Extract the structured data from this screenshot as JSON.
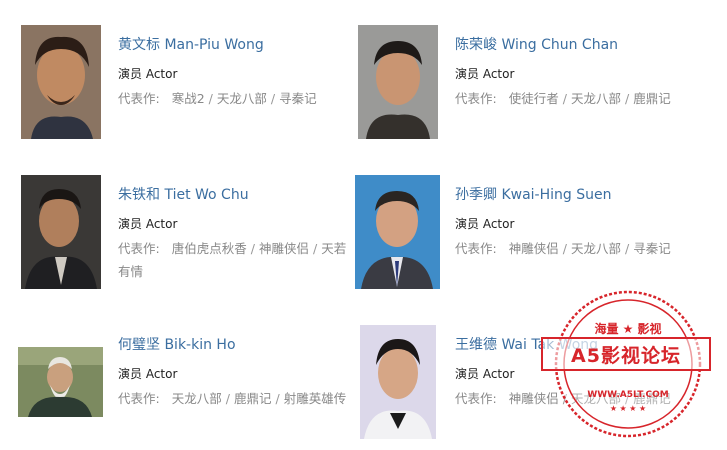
{
  "role_label": "演员 Actor",
  "works_label": "代表作:",
  "people": [
    {
      "name": "黄文标 Man-Piu Wong",
      "works": [
        "寒战2",
        "天龙八部",
        "寻秦记"
      ],
      "photo": "portrait-man-piu-wong"
    },
    {
      "name": "陈荣峻 Wing Chun Chan",
      "works": [
        "使徒行者",
        "天龙八部",
        "鹿鼎记"
      ],
      "photo": "portrait-wing-chun-chan"
    },
    {
      "name": "朱铁和 Tiet Wo Chu",
      "works": [
        "唐伯虎点秋香",
        "神雕侠侣",
        "天若有情"
      ],
      "photo": "portrait-tiet-wo-chu"
    },
    {
      "name": "孙季卿 Kwai-Hing Suen",
      "works": [
        "神雕侠侣",
        "天龙八部",
        "寻秦记"
      ],
      "photo": "portrait-kwai-hing-suen"
    },
    {
      "name": "何璧坚 Bik-kin Ho",
      "works": [
        "天龙八部",
        "鹿鼎记",
        "射雕英雄传"
      ],
      "photo": "portrait-bik-kin-ho"
    },
    {
      "name": "王维德 Wai Tak Wong",
      "works": [
        "神雕侠侣",
        "天龙八部",
        "鹿鼎记"
      ],
      "photo": "portrait-wai-tak-wong"
    }
  ],
  "watermark": {
    "top_text": "海量 ★ 影视",
    "main_text": "A5影视论坛",
    "url": "WWW.A5LT.COM",
    "color": "#d7252b"
  }
}
